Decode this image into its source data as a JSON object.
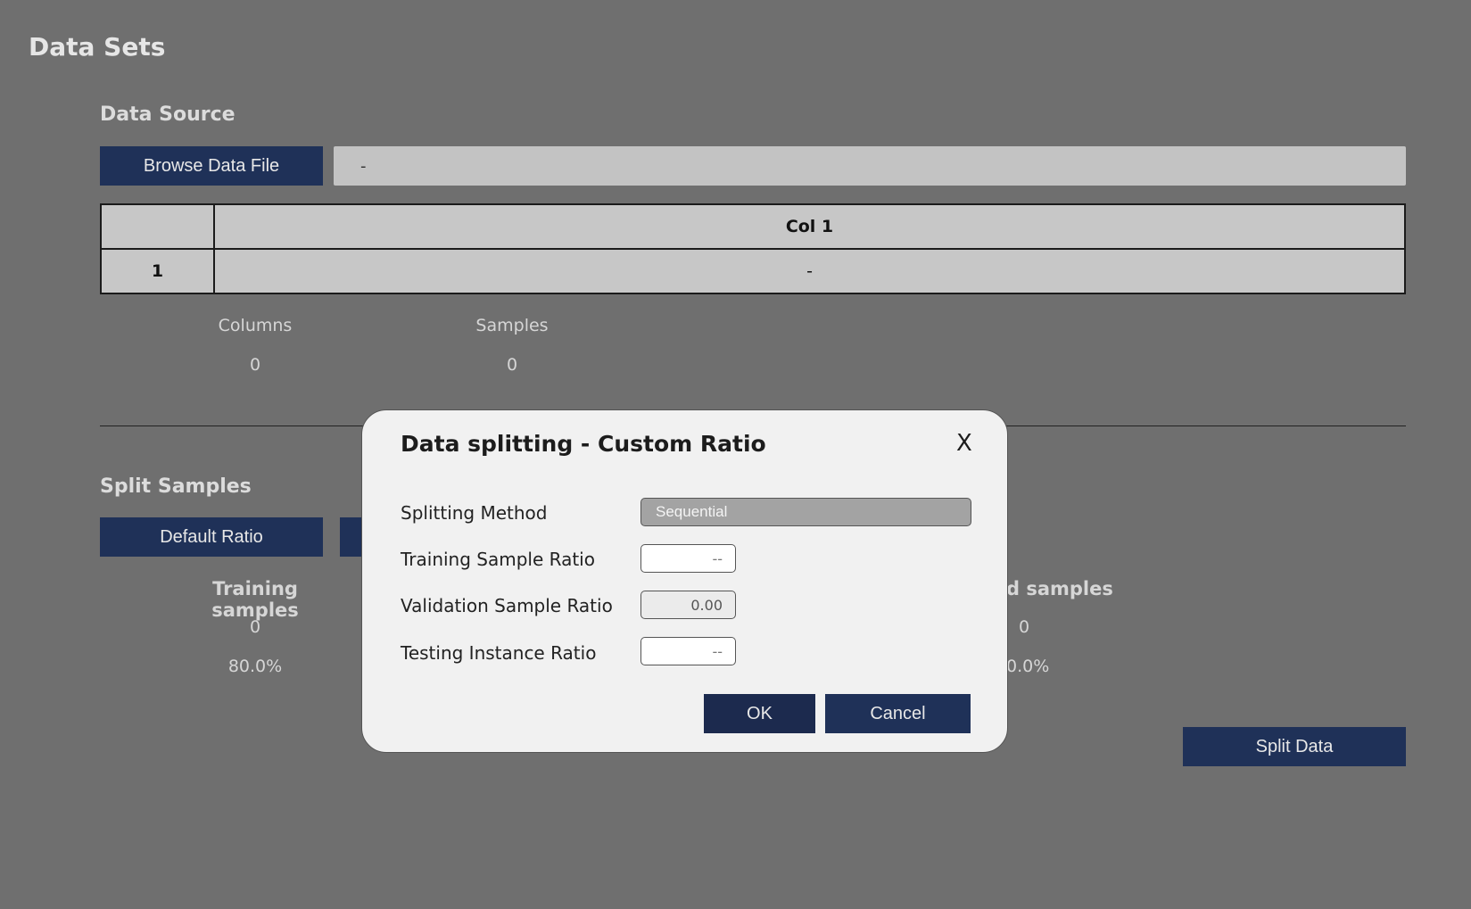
{
  "page": {
    "title": "Data Sets"
  },
  "data_source": {
    "heading": "Data Source",
    "browse_label": "Browse Data File",
    "file_path": "-"
  },
  "table": {
    "header_blank": "",
    "columns": [
      "Col 1"
    ],
    "rows": [
      {
        "index": "1",
        "cells": [
          "-"
        ]
      }
    ]
  },
  "stats": {
    "columns_label": "Columns",
    "columns_value": "0",
    "samples_label": "Samples",
    "samples_value": "0"
  },
  "split": {
    "heading": "Split Samples",
    "default_ratio_label": "Default Ratio",
    "training_label": "Training samples",
    "training_count": "0",
    "training_pct": "80.0%",
    "right_label_partial": "d samples",
    "right_count": "0",
    "right_pct_partial": "0.0%",
    "split_data_label": "Split Data"
  },
  "dialog": {
    "title": "Data splitting - Custom Ratio",
    "close_label": "X",
    "method_label": "Splitting Method",
    "method_value": "Sequential",
    "training_label": "Training Sample Ratio",
    "training_value": "--",
    "validation_label": "Validation Sample Ratio",
    "validation_value": "0.00",
    "testing_label": "Testing Instance Ratio",
    "testing_value": "--",
    "ok_label": "OK",
    "cancel_label": "Cancel"
  }
}
